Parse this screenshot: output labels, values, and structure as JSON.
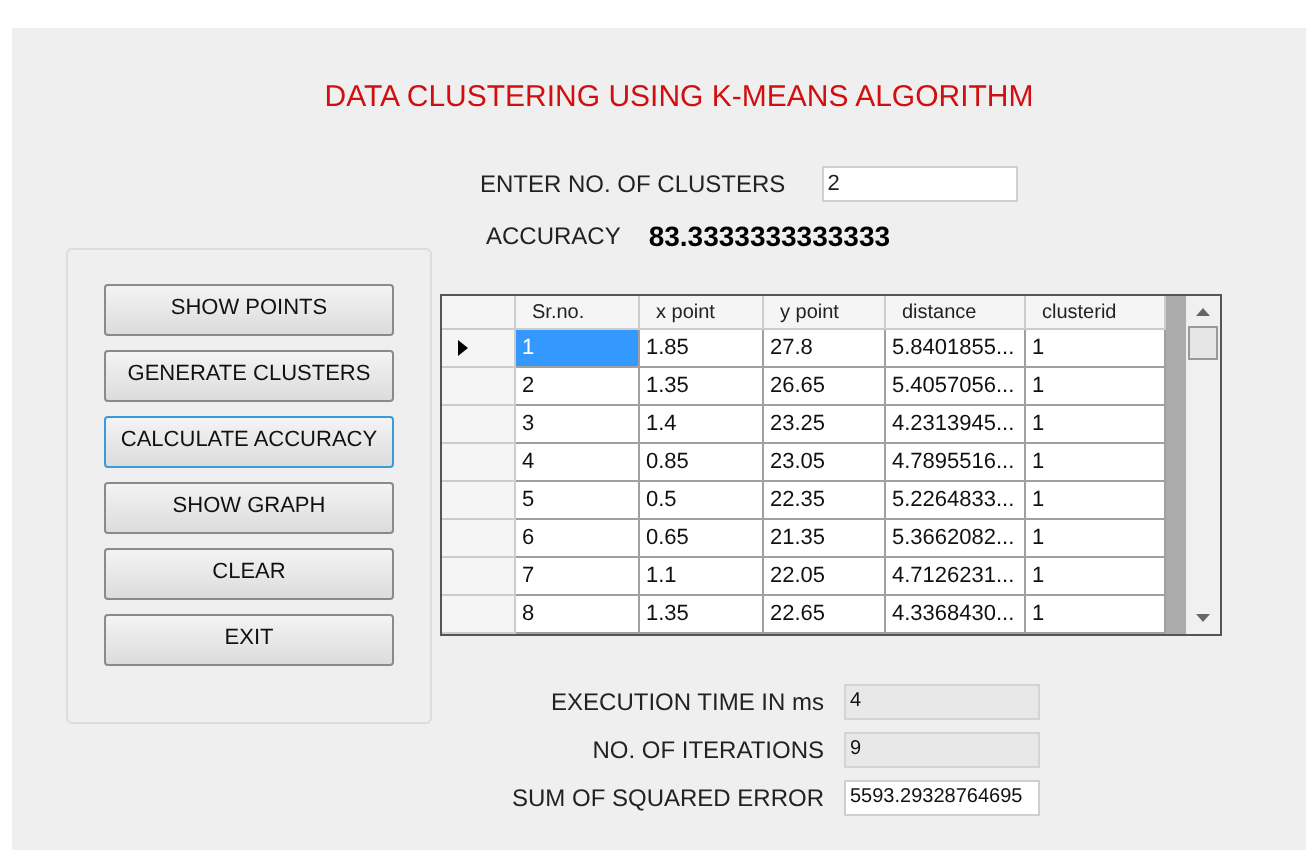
{
  "title": "DATA CLUSTERING USING  K-MEANS ALGORITHM",
  "clusters": {
    "label": "ENTER NO. OF CLUSTERS",
    "value": "2"
  },
  "accuracy": {
    "label": "ACCURACY",
    "value": "83.3333333333333"
  },
  "buttons": [
    {
      "label": "SHOW POINTS",
      "focused": false
    },
    {
      "label": "GENERATE CLUSTERS",
      "focused": false
    },
    {
      "label": "CALCULATE ACCURACY",
      "focused": true
    },
    {
      "label": "SHOW GRAPH",
      "focused": false
    },
    {
      "label": "CLEAR",
      "focused": false
    },
    {
      "label": "EXIT",
      "focused": false
    }
  ],
  "table": {
    "columns": [
      "Sr.no.",
      "x point",
      "y point",
      "distance",
      "clusterid"
    ],
    "rows": [
      {
        "cells": [
          "1",
          "1.85",
          "27.8",
          "5.8401855...",
          "1"
        ],
        "selected": true
      },
      {
        "cells": [
          "2",
          "1.35",
          "26.65",
          "5.4057056...",
          "1"
        ],
        "selected": false
      },
      {
        "cells": [
          "3",
          "1.4",
          "23.25",
          "4.2313945...",
          "1"
        ],
        "selected": false
      },
      {
        "cells": [
          "4",
          "0.85",
          "23.05",
          "4.7895516...",
          "1"
        ],
        "selected": false
      },
      {
        "cells": [
          "5",
          "0.5",
          "22.35",
          "5.2264833...",
          "1"
        ],
        "selected": false
      },
      {
        "cells": [
          "6",
          "0.65",
          "21.35",
          "5.3662082...",
          "1"
        ],
        "selected": false
      },
      {
        "cells": [
          "7",
          "1.1",
          "22.05",
          "4.7126231...",
          "1"
        ],
        "selected": false
      },
      {
        "cells": [
          "8",
          "1.35",
          "22.65",
          "4.3368430...",
          "1"
        ],
        "selected": false
      }
    ]
  },
  "results": [
    {
      "label": "EXECUTION TIME IN ms",
      "value": "4",
      "readonly": true
    },
    {
      "label": "NO. OF ITERATIONS",
      "value": "9",
      "readonly": true
    },
    {
      "label": "SUM OF SQUARED ERROR",
      "value": "5593.29328764695",
      "readonly": false
    }
  ]
}
